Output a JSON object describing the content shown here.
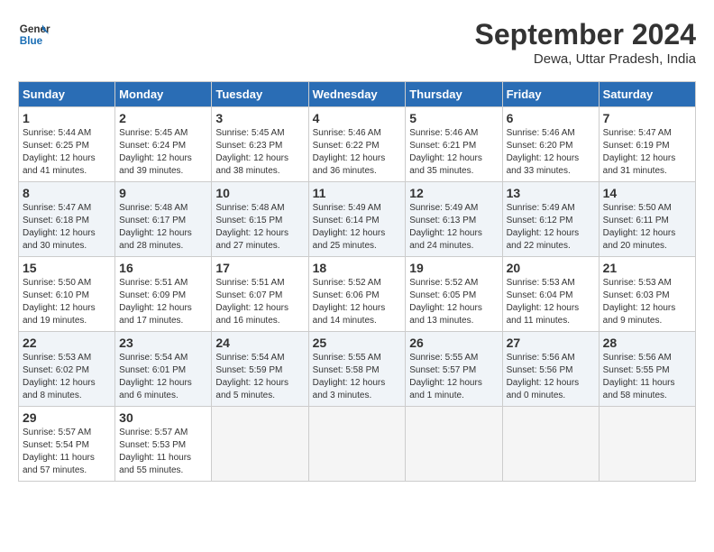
{
  "logo": {
    "text_general": "General",
    "text_blue": "Blue"
  },
  "title": {
    "month": "September 2024",
    "location": "Dewa, Uttar Pradesh, India"
  },
  "weekdays": [
    "Sunday",
    "Monday",
    "Tuesday",
    "Wednesday",
    "Thursday",
    "Friday",
    "Saturday"
  ],
  "weeks": [
    [
      {
        "day": "1",
        "sunrise": "Sunrise: 5:44 AM",
        "sunset": "Sunset: 6:25 PM",
        "daylight": "Daylight: 12 hours and 41 minutes."
      },
      {
        "day": "2",
        "sunrise": "Sunrise: 5:45 AM",
        "sunset": "Sunset: 6:24 PM",
        "daylight": "Daylight: 12 hours and 39 minutes."
      },
      {
        "day": "3",
        "sunrise": "Sunrise: 5:45 AM",
        "sunset": "Sunset: 6:23 PM",
        "daylight": "Daylight: 12 hours and 38 minutes."
      },
      {
        "day": "4",
        "sunrise": "Sunrise: 5:46 AM",
        "sunset": "Sunset: 6:22 PM",
        "daylight": "Daylight: 12 hours and 36 minutes."
      },
      {
        "day": "5",
        "sunrise": "Sunrise: 5:46 AM",
        "sunset": "Sunset: 6:21 PM",
        "daylight": "Daylight: 12 hours and 35 minutes."
      },
      {
        "day": "6",
        "sunrise": "Sunrise: 5:46 AM",
        "sunset": "Sunset: 6:20 PM",
        "daylight": "Daylight: 12 hours and 33 minutes."
      },
      {
        "day": "7",
        "sunrise": "Sunrise: 5:47 AM",
        "sunset": "Sunset: 6:19 PM",
        "daylight": "Daylight: 12 hours and 31 minutes."
      }
    ],
    [
      {
        "day": "8",
        "sunrise": "Sunrise: 5:47 AM",
        "sunset": "Sunset: 6:18 PM",
        "daylight": "Daylight: 12 hours and 30 minutes."
      },
      {
        "day": "9",
        "sunrise": "Sunrise: 5:48 AM",
        "sunset": "Sunset: 6:17 PM",
        "daylight": "Daylight: 12 hours and 28 minutes."
      },
      {
        "day": "10",
        "sunrise": "Sunrise: 5:48 AM",
        "sunset": "Sunset: 6:15 PM",
        "daylight": "Daylight: 12 hours and 27 minutes."
      },
      {
        "day": "11",
        "sunrise": "Sunrise: 5:49 AM",
        "sunset": "Sunset: 6:14 PM",
        "daylight": "Daylight: 12 hours and 25 minutes."
      },
      {
        "day": "12",
        "sunrise": "Sunrise: 5:49 AM",
        "sunset": "Sunset: 6:13 PM",
        "daylight": "Daylight: 12 hours and 24 minutes."
      },
      {
        "day": "13",
        "sunrise": "Sunrise: 5:49 AM",
        "sunset": "Sunset: 6:12 PM",
        "daylight": "Daylight: 12 hours and 22 minutes."
      },
      {
        "day": "14",
        "sunrise": "Sunrise: 5:50 AM",
        "sunset": "Sunset: 6:11 PM",
        "daylight": "Daylight: 12 hours and 20 minutes."
      }
    ],
    [
      {
        "day": "15",
        "sunrise": "Sunrise: 5:50 AM",
        "sunset": "Sunset: 6:10 PM",
        "daylight": "Daylight: 12 hours and 19 minutes."
      },
      {
        "day": "16",
        "sunrise": "Sunrise: 5:51 AM",
        "sunset": "Sunset: 6:09 PM",
        "daylight": "Daylight: 12 hours and 17 minutes."
      },
      {
        "day": "17",
        "sunrise": "Sunrise: 5:51 AM",
        "sunset": "Sunset: 6:07 PM",
        "daylight": "Daylight: 12 hours and 16 minutes."
      },
      {
        "day": "18",
        "sunrise": "Sunrise: 5:52 AM",
        "sunset": "Sunset: 6:06 PM",
        "daylight": "Daylight: 12 hours and 14 minutes."
      },
      {
        "day": "19",
        "sunrise": "Sunrise: 5:52 AM",
        "sunset": "Sunset: 6:05 PM",
        "daylight": "Daylight: 12 hours and 13 minutes."
      },
      {
        "day": "20",
        "sunrise": "Sunrise: 5:53 AM",
        "sunset": "Sunset: 6:04 PM",
        "daylight": "Daylight: 12 hours and 11 minutes."
      },
      {
        "day": "21",
        "sunrise": "Sunrise: 5:53 AM",
        "sunset": "Sunset: 6:03 PM",
        "daylight": "Daylight: 12 hours and 9 minutes."
      }
    ],
    [
      {
        "day": "22",
        "sunrise": "Sunrise: 5:53 AM",
        "sunset": "Sunset: 6:02 PM",
        "daylight": "Daylight: 12 hours and 8 minutes."
      },
      {
        "day": "23",
        "sunrise": "Sunrise: 5:54 AM",
        "sunset": "Sunset: 6:01 PM",
        "daylight": "Daylight: 12 hours and 6 minutes."
      },
      {
        "day": "24",
        "sunrise": "Sunrise: 5:54 AM",
        "sunset": "Sunset: 5:59 PM",
        "daylight": "Daylight: 12 hours and 5 minutes."
      },
      {
        "day": "25",
        "sunrise": "Sunrise: 5:55 AM",
        "sunset": "Sunset: 5:58 PM",
        "daylight": "Daylight: 12 hours and 3 minutes."
      },
      {
        "day": "26",
        "sunrise": "Sunrise: 5:55 AM",
        "sunset": "Sunset: 5:57 PM",
        "daylight": "Daylight: 12 hours and 1 minute."
      },
      {
        "day": "27",
        "sunrise": "Sunrise: 5:56 AM",
        "sunset": "Sunset: 5:56 PM",
        "daylight": "Daylight: 12 hours and 0 minutes."
      },
      {
        "day": "28",
        "sunrise": "Sunrise: 5:56 AM",
        "sunset": "Sunset: 5:55 PM",
        "daylight": "Daylight: 11 hours and 58 minutes."
      }
    ],
    [
      {
        "day": "29",
        "sunrise": "Sunrise: 5:57 AM",
        "sunset": "Sunset: 5:54 PM",
        "daylight": "Daylight: 11 hours and 57 minutes."
      },
      {
        "day": "30",
        "sunrise": "Sunrise: 5:57 AM",
        "sunset": "Sunset: 5:53 PM",
        "daylight": "Daylight: 11 hours and 55 minutes."
      },
      null,
      null,
      null,
      null,
      null
    ]
  ]
}
